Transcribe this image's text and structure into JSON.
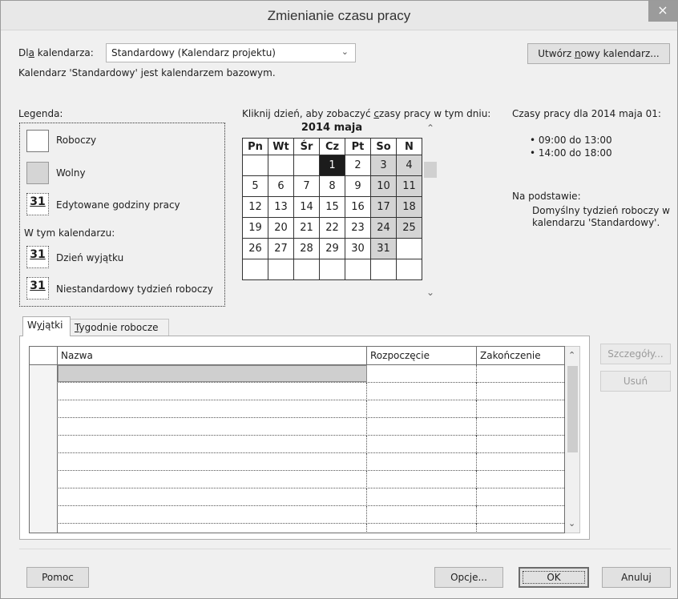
{
  "window": {
    "title": "Zmienianie czasu pracy",
    "close_glyph": "×"
  },
  "calendar_select": {
    "label": "Dla kalendarza:",
    "value": "Standardowy (Kalendarz projektu)",
    "note": "Kalendarz 'Standardowy' jest kalendarzem bazowym."
  },
  "buttons": {
    "new_calendar": "Utwórz nowy kalendarz...",
    "details": "Szczegóły...",
    "delete": "Usuń",
    "help": "Pomoc",
    "options": "Opcje...",
    "ok": "OK",
    "cancel": "Anuluj"
  },
  "legend": {
    "title": "Legenda:",
    "working": "Roboczy",
    "nonworking": "Wolny",
    "edited_hours": "Edytowane godziny pracy",
    "in_calendar": "W tym kalendarzu:",
    "exception_day": "Dzień wyjątku",
    "nondefault_week": "Niestandardowy tydzień roboczy",
    "sample_number": "31"
  },
  "calendar": {
    "instruction": "Kliknij dzień, aby zobaczyć czasy pracy w tym dniu:",
    "month_title": "2014 maja",
    "weekdays": [
      "Pn",
      "Wt",
      "Śr",
      "Cz",
      "Pt",
      "So",
      "N"
    ],
    "weeks": [
      [
        "",
        "",
        "",
        "1",
        "2",
        "3",
        "4"
      ],
      [
        "5",
        "6",
        "7",
        "8",
        "9",
        "10",
        "11"
      ],
      [
        "12",
        "13",
        "14",
        "15",
        "16",
        "17",
        "18"
      ],
      [
        "19",
        "20",
        "21",
        "22",
        "23",
        "24",
        "25"
      ],
      [
        "26",
        "27",
        "28",
        "29",
        "30",
        "31",
        ""
      ],
      [
        "",
        "",
        "",
        "",
        "",
        "",
        ""
      ]
    ],
    "selected_day": "1"
  },
  "working_times": {
    "title": "Czasy pracy dla 2014 maja 01:",
    "ranges": [
      "• 09:00 do 13:00",
      "• 14:00 do 18:00"
    ],
    "basis_label": "Na podstawie:",
    "basis_text": "Domyślny tydzień roboczy w kalendarzu 'Standardowy'."
  },
  "tabs": [
    "Wyjątki",
    "Tygodnie robocze"
  ],
  "exceptions_table": {
    "columns": [
      "Nazwa",
      "Rozpoczęcie",
      "Zakończenie"
    ],
    "row_count": 10
  },
  "colors": {
    "selected_day": "#1c1c1c",
    "nonworking": "#d4d4d4",
    "close_button": "#9b9b9b"
  }
}
